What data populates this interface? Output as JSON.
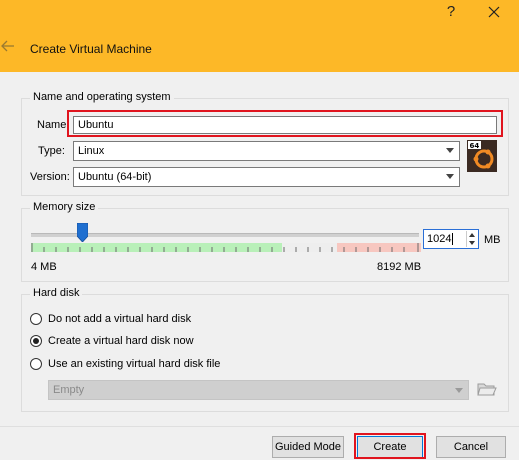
{
  "window": {
    "title": "Create Virtual Machine",
    "help_label": "?"
  },
  "name_os": {
    "legend": "Name and operating system",
    "name_label": "Name",
    "name_value": "Ubuntu",
    "type_label": "Type:",
    "type_value": "Linux",
    "version_label": "Version:",
    "version_value": "Ubuntu (64-bit)",
    "os_icon_badge": "64"
  },
  "memory": {
    "legend": "Memory size",
    "value": "1024",
    "unit": "MB",
    "min_label": "4 MB",
    "max_label": "8192 MB",
    "slider_fraction": 0.125
  },
  "hard_disk": {
    "legend": "Hard disk",
    "options": [
      {
        "label": "Do not add a virtual hard disk",
        "checked": false
      },
      {
        "label": "Create a virtual hard disk now",
        "checked": true
      },
      {
        "label": "Use an existing virtual hard disk file",
        "checked": false
      }
    ],
    "existing_file_value": "Empty"
  },
  "buttons": {
    "guided_mode": "Guided Mode",
    "create": "Create",
    "cancel": "Cancel"
  },
  "colors": {
    "title_bar": "#fdb827",
    "highlight": "#e0141e",
    "slider_green": "#b9f0b9",
    "slider_red": "#f7c7c0"
  }
}
